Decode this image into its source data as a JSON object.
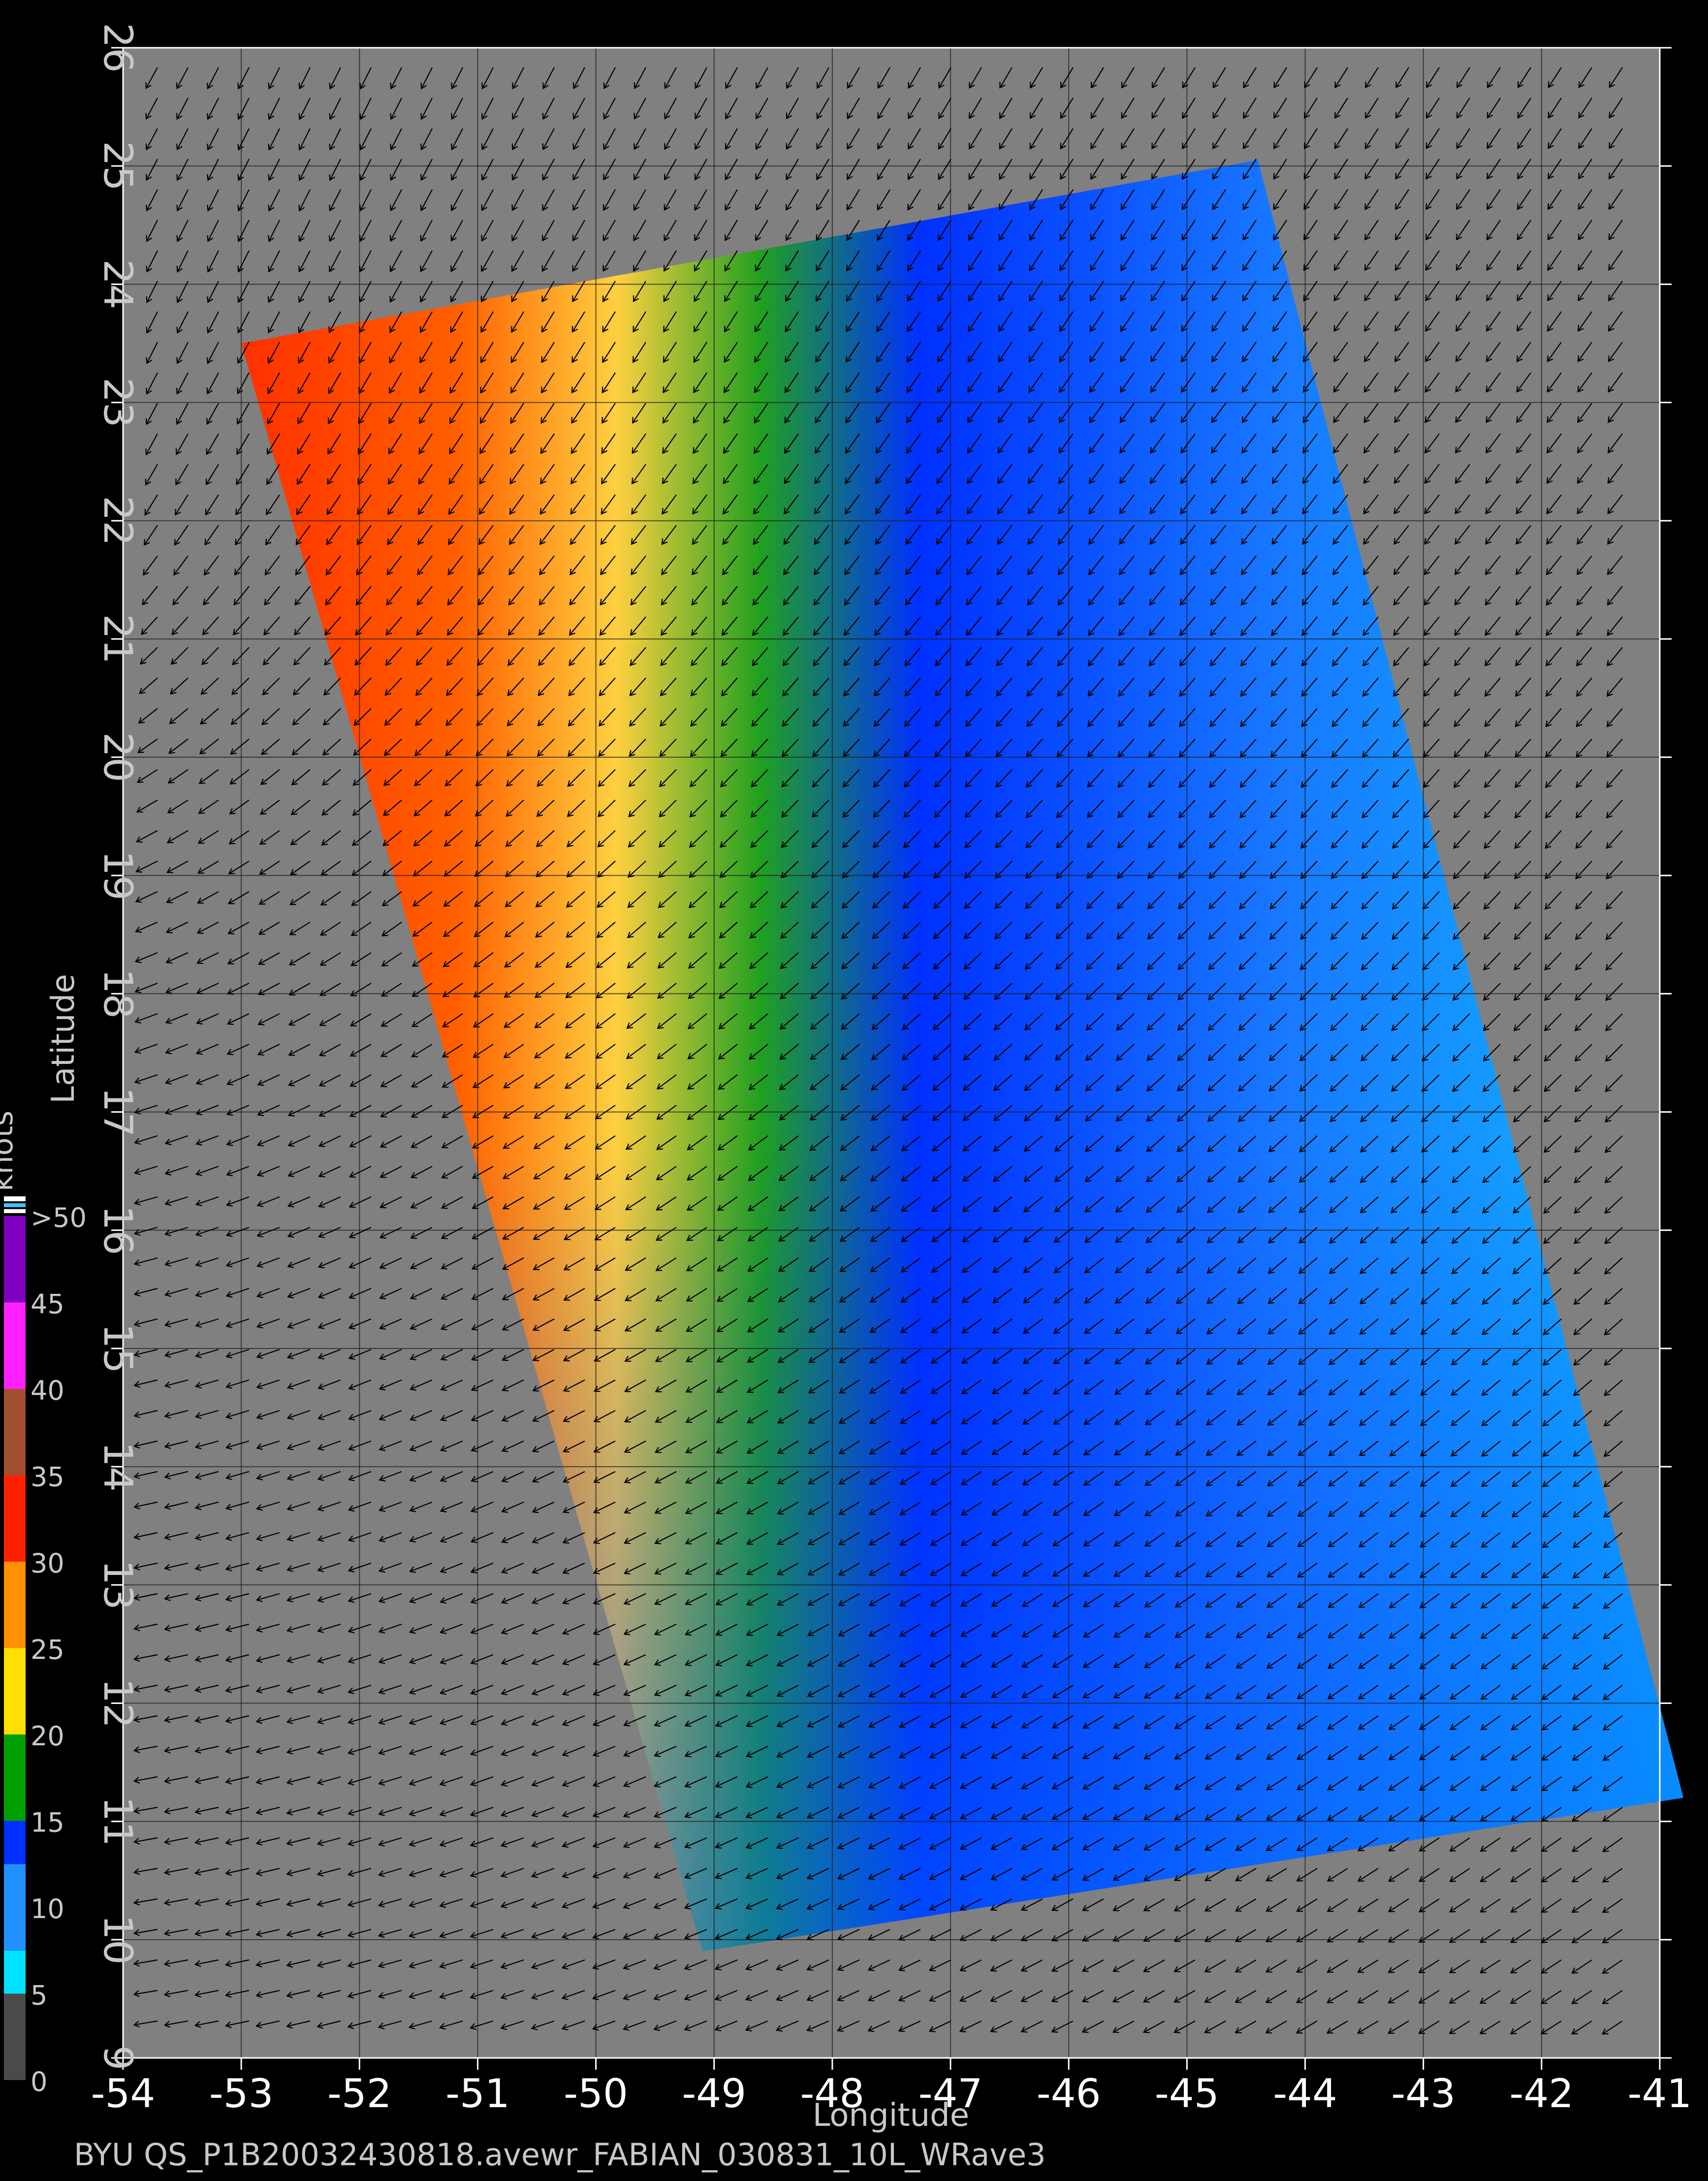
{
  "map": {
    "lon_ticks": [
      "-54",
      "-53",
      "-52",
      "-51",
      "-50",
      "-49",
      "-48",
      "-47",
      "-46",
      "-45",
      "-44",
      "-43",
      "-42",
      "-41"
    ],
    "lat_ticks": [
      "9",
      "10",
      "11",
      "12",
      "13",
      "14",
      "15",
      "16",
      "17",
      "18",
      "19",
      "20",
      "21",
      "22",
      "23",
      "24",
      "25",
      "26"
    ],
    "lon_range": [
      -54,
      -41
    ],
    "lat_range": [
      9,
      26
    ],
    "xlabel": "Longitude",
    "ylabel": "Latitude",
    "caption": "BYU  QS_P1B20032430818.avewr_FABIAN_030831_10L_WRave3",
    "background_color": "#808080",
    "swath_corners": [
      [
        -53,
        23.5
      ],
      [
        -44.4,
        25.05
      ],
      [
        -40.8,
        11.2
      ],
      [
        -49.1,
        9.9
      ]
    ],
    "colorbar": {
      "unit": "knots",
      "labels": [
        "0",
        "5",
        "10",
        "15",
        "20",
        "25",
        "30",
        "35",
        "40",
        "45",
        ">50"
      ],
      "colors": [
        "#4a4a4a",
        "#00e0ff",
        "#2090ff",
        "#0030ff",
        "#00a000",
        "#ffe000",
        "#ff9000",
        "#ff2000",
        "#a05030",
        "#ff20ff",
        "#8000c0",
        "#ffffff"
      ]
    }
  }
}
